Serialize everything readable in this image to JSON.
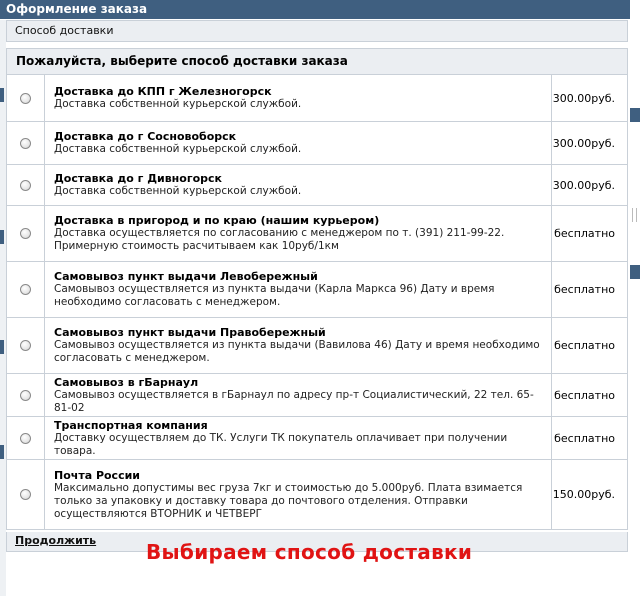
{
  "header": {
    "title": "Оформление заказа"
  },
  "section": {
    "subheader": "Способ доставки"
  },
  "delivery": {
    "title": "Пожалуйста, выберите способ доставки заказа",
    "options": [
      {
        "title": "Доставка до КПП г Железногорск",
        "desc": "Доставка собственной курьерской службой.",
        "price": "300.00руб."
      },
      {
        "title": "Доставка до г Сосновоборск",
        "desc": "Доставка собственной курьерской службой.",
        "price": "300.00руб."
      },
      {
        "title": "Доставка до г Дивногорск",
        "desc": "Доставка собственной курьерской службой.",
        "price": "300.00руб."
      },
      {
        "title": "Доставка в пригород и по краю (нашим курьером)",
        "desc": "Доставка осуществляется по согласованию с менеджером по т. (391) 211-99-22. Примерную стоимость расчитываем как 10руб/1км",
        "price": "бесплатно"
      },
      {
        "title": "Самовывоз пункт выдачи Левобережный",
        "desc": "Самовывоз осуществляется из пункта выдачи (Карла Маркса 96) Дату и время необходимо согласовать с менеджером.",
        "price": "бесплатно"
      },
      {
        "title": "Самовывоз пункт выдачи Правобережный",
        "desc": "Самовывоз осуществляется из пункта выдачи (Вавилова 46) Дату и время необходимо согласовать с менеджером.",
        "price": "бесплатно"
      },
      {
        "title": "Самовывоз в гБарнаул",
        "desc": "Самовывоз осуществляется в гБарнаул по адресу пр-т Социалистический, 22 тел. 65-81-02",
        "price": "бесплатно"
      },
      {
        "title": "Транспортная компания",
        "desc": "Доставку осуществляем до ТК. Услуги ТК покупатель оплачивает при получении товара.",
        "price": "бесплатно"
      },
      {
        "title": "Почта России",
        "desc": "Максимально допустимы вес груза 7кг и стоимостью до 5.000руб. Плата взимается только за упаковку и доставку товара до почтового отделения. Отправки осуществляются ВТОРНИК и ЧЕТВЕРГ",
        "price": "150.00руб."
      }
    ]
  },
  "footer": {
    "continue_label": "Продолжить"
  },
  "annotation": {
    "text": "Выбираем способ доставки"
  },
  "colors": {
    "header_bg": "#3f5f80",
    "annotation": "#e01414"
  }
}
